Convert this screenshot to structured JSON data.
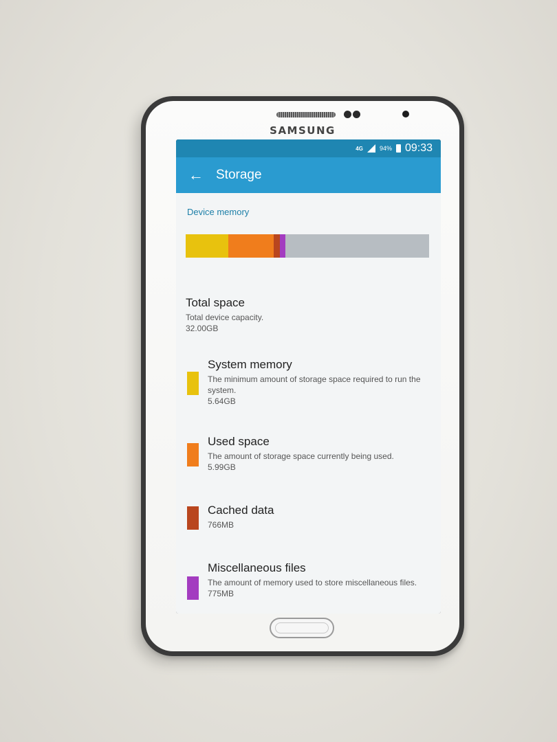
{
  "phone": {
    "brand": "SAMSUNG"
  },
  "status_bar": {
    "network": "4G",
    "battery_percent": "94%",
    "time": "09:33"
  },
  "app_bar": {
    "back_icon": "arrow-left-icon",
    "title": "Storage"
  },
  "section": {
    "label": "Device memory"
  },
  "usage_bar": {
    "segments": [
      {
        "name": "System memory",
        "color": "#e8c20e",
        "fraction": 0.176
      },
      {
        "name": "Used space",
        "color": "#f07d1c",
        "fraction": 0.187
      },
      {
        "name": "Cached data",
        "color": "#b9461e",
        "fraction": 0.024
      },
      {
        "name": "Miscellaneous files",
        "color": "#a33cc0",
        "fraction": 0.023
      }
    ],
    "free_color": "#b7bdc2"
  },
  "total": {
    "title": "Total space",
    "desc": "Total device capacity.",
    "size": "32.00GB"
  },
  "items": [
    {
      "title": "System memory",
      "desc": "The minimum amount of storage space required to run the system.",
      "size": "5.64GB",
      "color": "#e8c20e"
    },
    {
      "title": "Used space",
      "desc": "The amount of storage space currently being used.",
      "size": "5.99GB",
      "color": "#f07d1c"
    },
    {
      "title": "Cached data",
      "desc": "",
      "size": "766MB",
      "color": "#b9461e"
    },
    {
      "title": "Miscellaneous files",
      "desc": "The amount of memory used to store miscellaneous files.",
      "size": "775MB",
      "color": "#a33cc0"
    }
  ]
}
